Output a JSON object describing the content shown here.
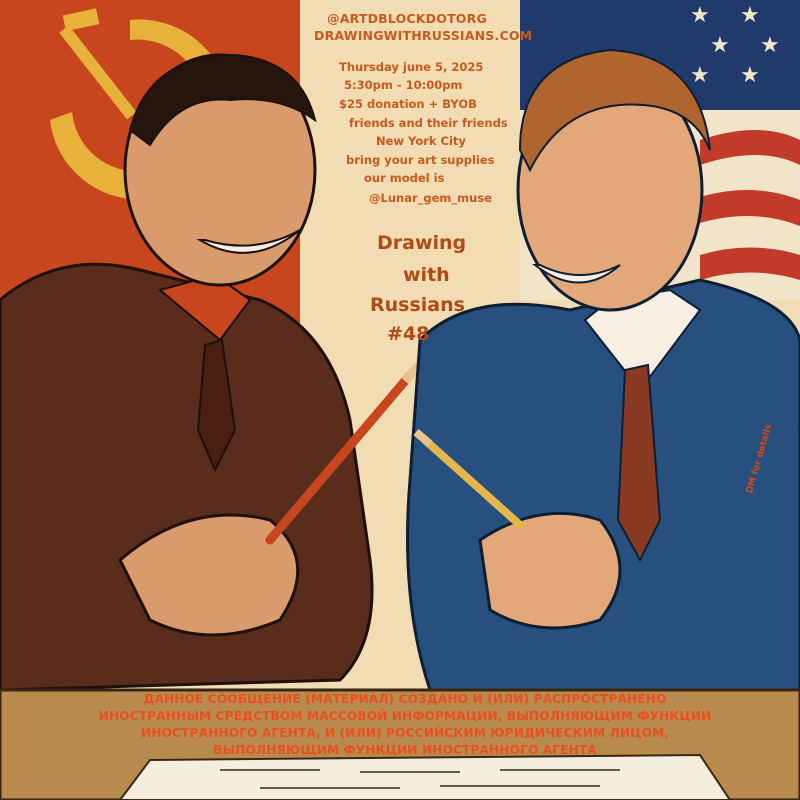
{
  "contact": {
    "handle": "@ARTDBLOCKDOTORG",
    "website": "DRAWINGWITHRUSSIANS.COM"
  },
  "event": {
    "date": "Thursday june 5, 2025",
    "time": "5:30pm - 10:00pm",
    "price": "$25 donation + BYOB",
    "audience": "friends and their friends",
    "location": "New York City",
    "supplies": "bring your art supplies",
    "model_intro": "our model is",
    "model_handle": "@Lunar_gem_muse"
  },
  "title": {
    "line1": "Drawing",
    "line2": "with",
    "line3": "Russians",
    "line4": "#48"
  },
  "side_note": "DM for details",
  "disclaimer": {
    "line1": "ДАННОЕ СООБЩЕНИЕ (МАТЕРИАЛ) СОЗДАНО И (ИЛИ) РАСПРОСТРАНЕНО",
    "line2": "ИНОСТРАННЫМ СРЕДСТВОМ МАССОВОЙ ИНФОРМАЦИИ, ВЫПОЛНЯЮЩИМ ФУНКЦИИ",
    "line3": "ИНОСТРАННОГО АГЕНТА, И (ИЛИ) РОССИЙСКИМ ЮРИДИЧЕСКИМ ЛИЦОМ,",
    "line4": "ВЫПОЛНЯЮЩИМ ФУНКЦИИ ИНОСТРАННОГО АГЕНТА"
  },
  "colors": {
    "soviet_red": "#c8461e",
    "sickle_gold": "#e8b23a",
    "us_blue": "#1f3a6b",
    "us_red": "#c23a2a",
    "paper": "#f1dcb4",
    "text_orange": "#c85a1e",
    "brown_suit": "#5a2c1c",
    "blue_suit": "#27507e"
  },
  "icons": [
    "hammer-and-sickle-icon",
    "american-flag-icon",
    "pencil-icon"
  ]
}
